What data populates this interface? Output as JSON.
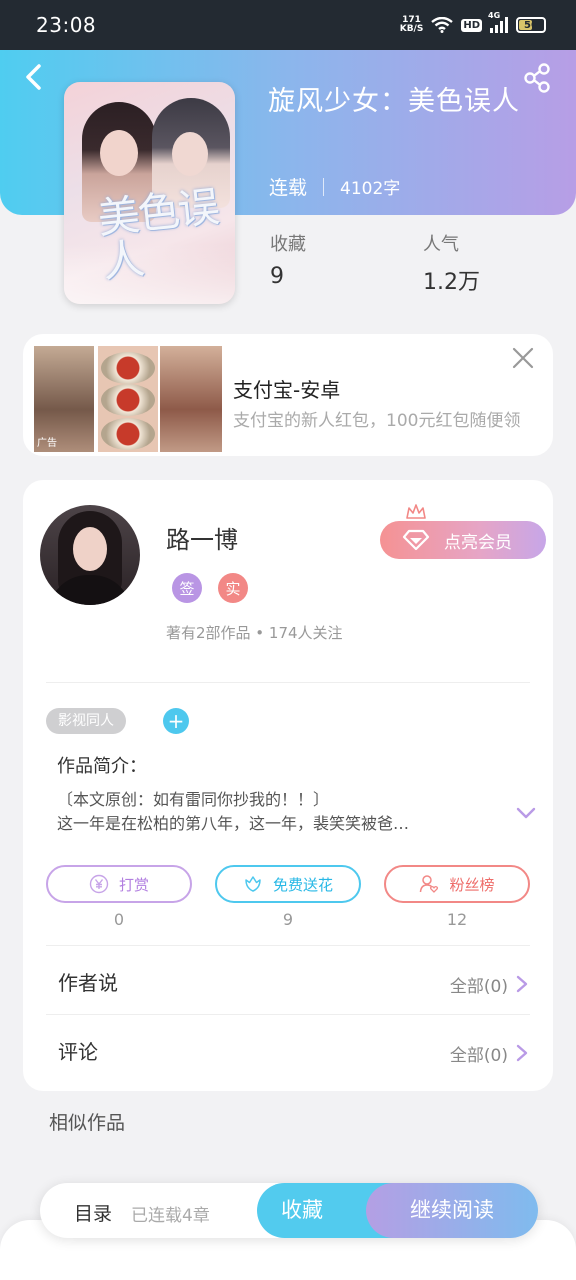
{
  "status_bar": {
    "time": "23:08",
    "net_speed_value": "171",
    "net_speed_unit": "KB/S",
    "hd": "HD",
    "network": "4G",
    "battery": "50"
  },
  "book": {
    "title": "旋风少女：美色误人",
    "status": "连载",
    "word_count": "4102字",
    "cover_title": "美色误人",
    "stats": [
      {
        "label": "收藏",
        "value": "9"
      },
      {
        "label": "人气",
        "value": "1.2万"
      }
    ]
  },
  "ad": {
    "tag": "广告",
    "name": "支付宝-安卓",
    "description": "支付宝的新人红包，100元红包随便领"
  },
  "author": {
    "name": "路一博",
    "badge_sign": "签",
    "badge_real": "实",
    "works_info": "著有2部作品 • 174人关注",
    "vip_button": "点亮会员"
  },
  "work": {
    "tag": "影视同人",
    "add_tag": "+",
    "intro_heading": "作品简介：",
    "intro_lines": [
      "〔本文原创：如有雷同你抄我的！！〕",
      "这一年是在松柏的第八年，这一年，裴笑笑被爸…"
    ]
  },
  "actions": [
    {
      "label": "打赏",
      "count": "0",
      "icon": "yen-icon"
    },
    {
      "label": "免费送花",
      "count": "9",
      "icon": "flower-icon"
    },
    {
      "label": "粉丝榜",
      "count": "12",
      "icon": "fan-icon"
    }
  ],
  "rows": {
    "author_says": {
      "label": "作者说",
      "value": "全部(0)"
    },
    "comments": {
      "label": "评论",
      "value": "全部(0)"
    }
  },
  "similar_heading": "相似作品",
  "bottom": {
    "toc": "目录",
    "chapters": "已连载4章",
    "collect": "收藏",
    "read": "继续阅读"
  },
  "colors": {
    "accent_blue": "#4ec8ee",
    "accent_purple": "#b79ee6",
    "accent_red": "#f28886"
  }
}
